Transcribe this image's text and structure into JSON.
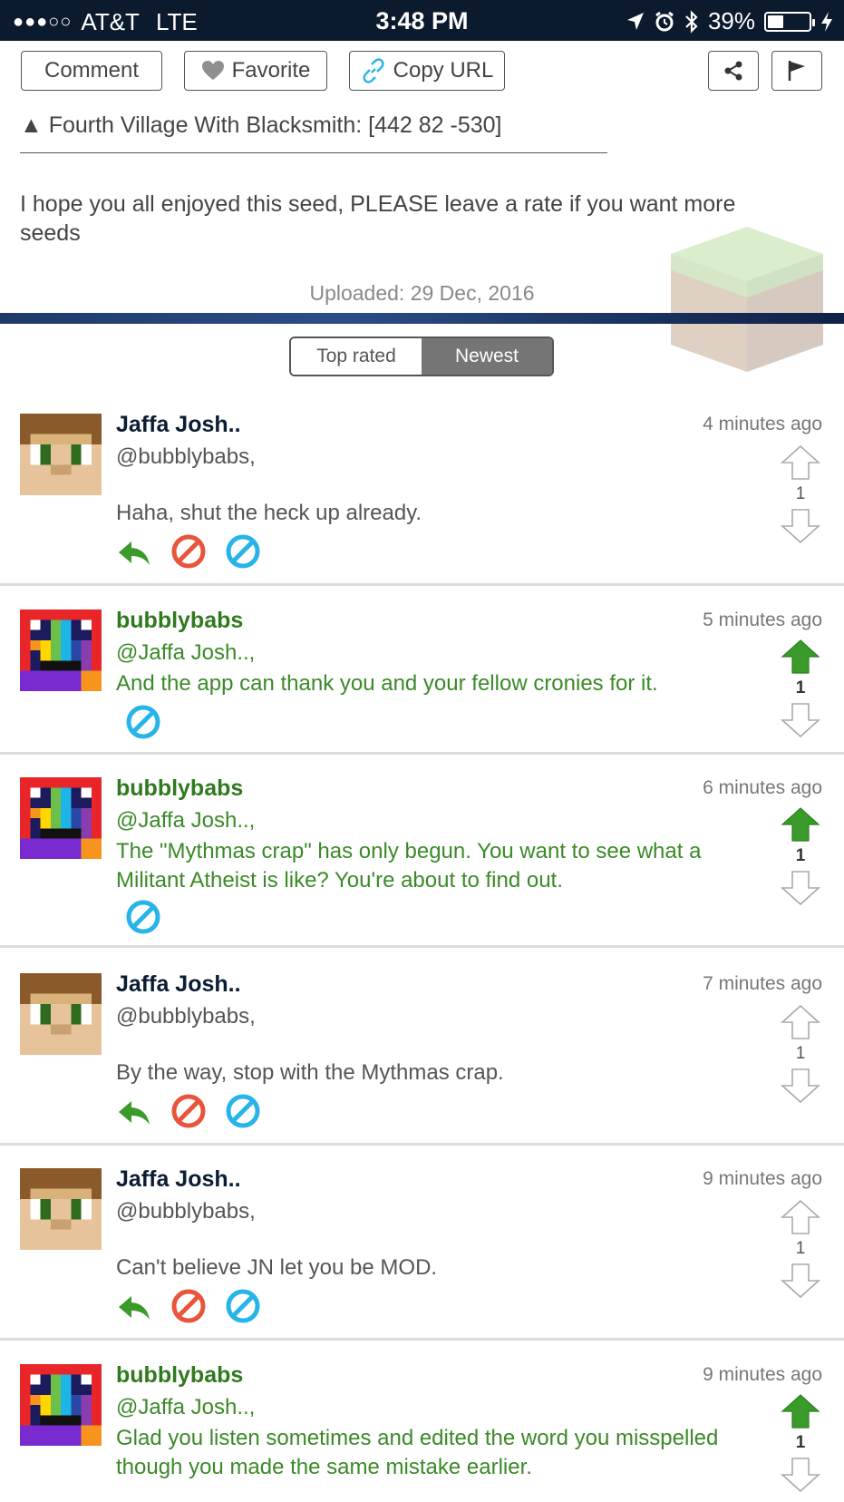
{
  "status_bar": {
    "signal": "●●●○○",
    "carrier": "AT&T",
    "network": "LTE",
    "time": "3:48 PM",
    "battery": "39%",
    "battery_level": 0.39
  },
  "toolbar": {
    "comment_label": "Comment",
    "favorite_label": "Favorite",
    "copy_url_label": "Copy URL"
  },
  "seed": {
    "last_line": "▲ Fourth Village With Blacksmith: [442 82 -530]",
    "message": "I hope you all enjoyed this seed, PLEASE leave a rate if you want more seeds",
    "uploaded": "Uploaded: 29 Dec, 2016"
  },
  "sort": {
    "options": [
      "Top rated",
      "Newest"
    ],
    "selected": "Newest"
  },
  "colors": {
    "header": "#0c1a2e",
    "jaffa_name": "#0b1c33",
    "bubbly_name": "#2f7a1e",
    "bubbly_text": "#3a8a28",
    "upvote_active": "#3a9a2a",
    "reply": "#3a9a2a",
    "delete": "#e8553c",
    "block": "#27b4e8"
  },
  "comments": [
    {
      "author": "Jaffa Josh..",
      "time": "4 minutes ago",
      "mention": "@bubblybabs,",
      "text": "Haha, shut the heck up already.",
      "votes": "1",
      "upvoted": false
    },
    {
      "author": "bubblybabs",
      "time": "5 minutes ago",
      "mention": "@Jaffa Josh..,",
      "text": "And the app can thank you and your fellow cronies for it.",
      "votes": "1",
      "upvoted": true
    },
    {
      "author": "bubblybabs",
      "time": "6 minutes ago",
      "mention": "@Jaffa Josh..,",
      "text": "The \"Mythmas crap\" has only begun. You want to see what a Militant Atheist is like? You're about to find out.",
      "votes": "1",
      "upvoted": true
    },
    {
      "author": "Jaffa Josh..",
      "time": "7 minutes ago",
      "mention": "@bubblybabs,",
      "text": "By the way, stop with the Mythmas crap.",
      "votes": "1",
      "upvoted": false
    },
    {
      "author": "Jaffa Josh..",
      "time": "9 minutes ago",
      "mention": "@bubblybabs,",
      "text": "Can't believe JN let you be MOD.",
      "votes": "1",
      "upvoted": false
    },
    {
      "author": "bubblybabs",
      "time": "9 minutes ago",
      "mention": "@Jaffa Josh..,",
      "text": "Glad you listen sometimes and edited the word you misspelled though you made the same mistake earlier.",
      "votes": "1",
      "upvoted": true
    }
  ]
}
